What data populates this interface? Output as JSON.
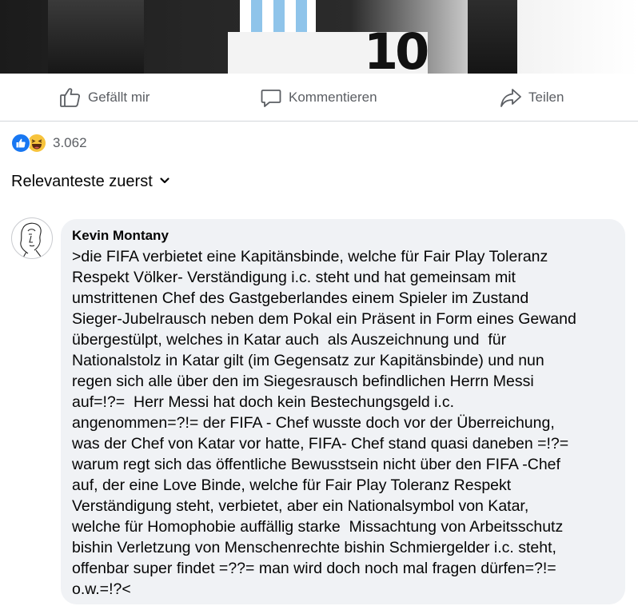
{
  "post_actions": {
    "like_label": "Gefällt mir",
    "comment_label": "Kommentieren",
    "share_label": "Teilen"
  },
  "reactions": {
    "icons": [
      "like-reaction-icon",
      "haha-reaction-icon"
    ],
    "count": "3.062",
    "colors": {
      "like": "#1877f2",
      "haha": "#f7c33c"
    }
  },
  "sort": {
    "label": "Relevanteste zuerst"
  },
  "comment": {
    "author": "Kevin Montany",
    "lines": [
      ">die FIFA verbietet eine Kapitänsbinde, welche für Fair Play Toleranz",
      "Respekt Völker- Verständigung i.c. steht und hat gemeinsam mit",
      "umstrittenen Chef des Gastgeberlandes einem Spieler im Zustand",
      "Sieger-Jubelrausch neben dem Pokal ein Präsent in Form eines Gewand",
      "übergestülpt, welches in Katar auch  als Auszeichnung und  für",
      "Nationalstolz in Katar gilt (im Gegensatz zur Kapitänsbinde) und nun",
      "regen sich alle über den im Siegesrausch befindlichen Herrn Messi",
      "auf=!?=  Herr Messi hat doch kein Bestechungsgeld i.c.",
      "angenommen=?!= der FIFA - Chef wusste doch vor der Überreichung,",
      "was der Chef von Katar vor hatte, FIFA- Chef stand quasi daneben =!?=",
      "warum regt sich das öffentliche Bewusstsein nicht über den FIFA -Chef",
      "auf, der eine Love Binde, welche für Fair Play Toleranz Respekt",
      "Verständigung steht, verbietet, aber ein Nationalsymbol von Katar,",
      "welche für Homophobie auffällig starke  Missachtung von Arbeitsschutz",
      "bishin Verletzung von Menschenrechte bishin Schmiergelder i.c. steht,",
      "offenbar super findet =??= man wird doch noch mal fragen dürfen=?!=",
      "o.w.=!?<"
    ]
  }
}
